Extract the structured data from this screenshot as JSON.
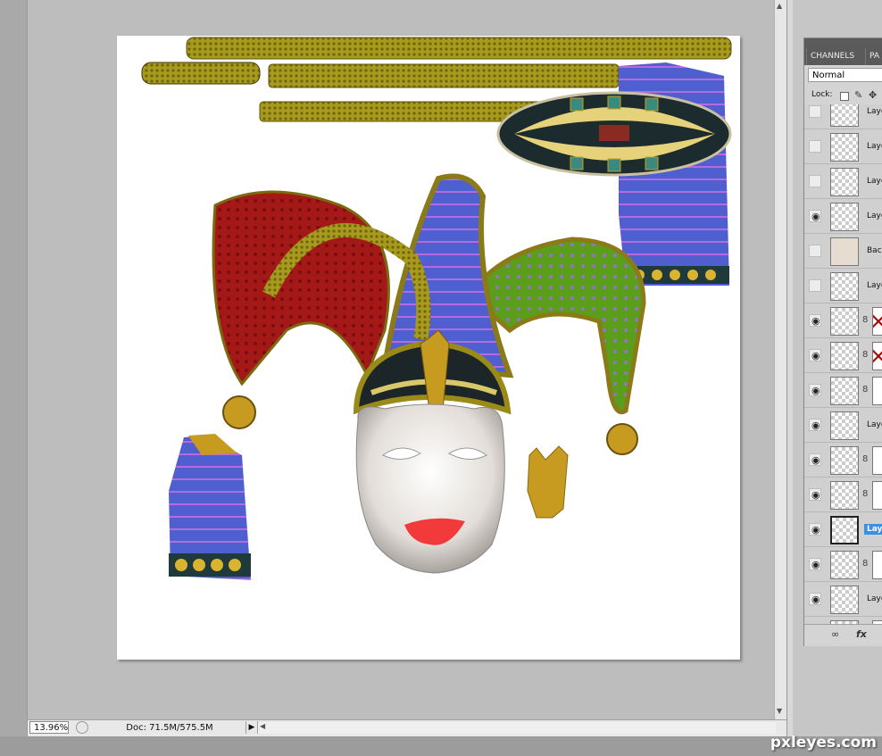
{
  "statusbar": {
    "zoom": "13.96%",
    "doc_info": "Doc: 71.5M/575.5M"
  },
  "watermark": "pxleyes.com",
  "panel": {
    "tabs": [
      "CHANNELS",
      "PA"
    ],
    "blend_mode": "Normal",
    "lock_label": "Lock:",
    "layers": [
      {
        "name": "Laye",
        "visible": false,
        "mask": "none",
        "thumb": "checker"
      },
      {
        "name": "Laye",
        "visible": false,
        "mask": "none",
        "thumb": "checker"
      },
      {
        "name": "Laye",
        "visible": false,
        "mask": "none",
        "thumb": "checker"
      },
      {
        "name": "Laye",
        "visible": true,
        "mask": "none",
        "thumb": "checker"
      },
      {
        "name": "Back",
        "visible": false,
        "mask": "none",
        "thumb": "bg"
      },
      {
        "name": "Laye",
        "visible": false,
        "mask": "none",
        "thumb": "checker"
      },
      {
        "name": "",
        "visible": true,
        "mask": "red",
        "thumb": "checker"
      },
      {
        "name": "",
        "visible": true,
        "mask": "red",
        "thumb": "checker"
      },
      {
        "name": "",
        "visible": true,
        "mask": "white",
        "thumb": "checker"
      },
      {
        "name": "Laye",
        "visible": true,
        "mask": "none",
        "thumb": "checker"
      },
      {
        "name": "",
        "visible": true,
        "mask": "white",
        "thumb": "checker"
      },
      {
        "name": "",
        "visible": true,
        "mask": "white",
        "thumb": "checker"
      },
      {
        "name": "Laye",
        "visible": true,
        "mask": "none",
        "thumb": "sel",
        "selected": true
      },
      {
        "name": "",
        "visible": true,
        "mask": "white",
        "thumb": "checker"
      },
      {
        "name": "Laye",
        "visible": true,
        "mask": "none",
        "thumb": "checker"
      },
      {
        "name": "",
        "visible": false,
        "mask": "white",
        "thumb": "checker"
      }
    ]
  },
  "icons": {
    "eye": "eye-icon",
    "chain": "link-icon",
    "fx": "fx-icon"
  },
  "colors": {
    "selection": "#3a8ee6",
    "gold": "#a89a1c",
    "blue": "#4f5fd0",
    "red": "#a41818",
    "green": "#5a9e1c"
  }
}
